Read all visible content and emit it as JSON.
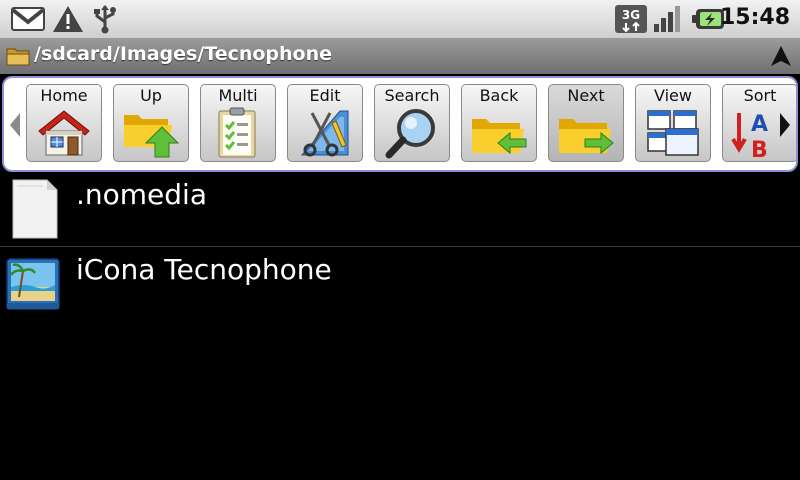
{
  "status_bar": {
    "time": "15:48",
    "network": "3G",
    "icons": [
      "gmail-icon",
      "warning-icon",
      "usb-icon",
      "3g-data-icon",
      "signal-icon",
      "battery-charging-icon"
    ]
  },
  "path_bar": {
    "path": "/sdcard/Images/Tecnophone"
  },
  "toolbar": {
    "buttons": [
      {
        "label": "Home",
        "icon": "home-icon"
      },
      {
        "label": "Up",
        "icon": "folder-up-icon"
      },
      {
        "label": "Multi",
        "icon": "clipboard-check-icon"
      },
      {
        "label": "Edit",
        "icon": "edit-tools-icon"
      },
      {
        "label": "Search",
        "icon": "magnifier-icon"
      },
      {
        "label": "Back",
        "icon": "folder-back-icon"
      },
      {
        "label": "Next",
        "icon": "folder-next-icon"
      },
      {
        "label": "View",
        "icon": "view-windows-icon"
      },
      {
        "label": "Sort",
        "icon": "sort-ab-icon"
      }
    ]
  },
  "files": [
    {
      "name": ".nomedia",
      "icon": "blank-file-icon"
    },
    {
      "name": "iCona Tecnophone",
      "icon": "image-file-icon"
    }
  ],
  "colors": {
    "toolbar_border": "#8d8dd8",
    "folder_yellow": "#f5c400",
    "arrow_green": "#5fbf3a"
  }
}
